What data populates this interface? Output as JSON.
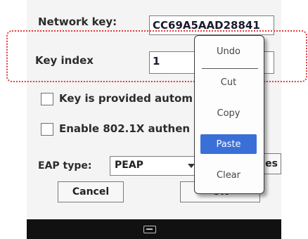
{
  "form": {
    "network_key_label": "Network key:",
    "network_key_value": "CC69A5AAD28841",
    "key_index_label": "Key index",
    "key_index_value": "1",
    "auto_key_label": "Key is provided autom",
    "enable_8021x_label": "Enable 802.1X authen",
    "eap_type_label": "EAP type:",
    "eap_type_value": "PEAP",
    "properties_partial": "es",
    "cancel_label": "Cancel",
    "ok_label": "OK"
  },
  "context_menu": {
    "items": [
      {
        "label": "Undo",
        "selected": false
      },
      {
        "label": "Cut",
        "selected": false
      },
      {
        "label": "Copy",
        "selected": false
      },
      {
        "label": "Paste",
        "selected": true
      },
      {
        "label": "Clear",
        "selected": false
      }
    ]
  },
  "taskbar": {
    "icon": "keyboard-icon"
  },
  "colors": {
    "highlight_frame": "#e23b3b",
    "menu_selection": "#3b6fd8",
    "taskbar": "#111111"
  }
}
